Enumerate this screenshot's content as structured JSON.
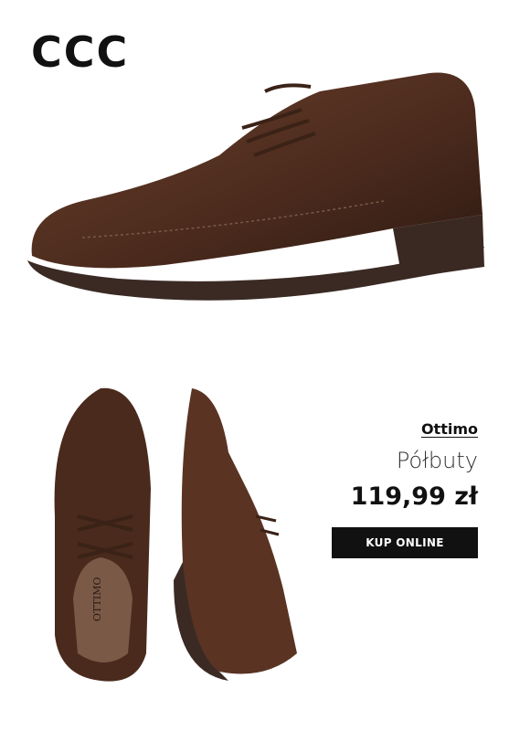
{
  "logo": "CCC",
  "product": {
    "brand": "Ottimo",
    "category": "Półbuty",
    "price": "119,99 zł",
    "cta": "KUP ONLINE",
    "insole_text": "OTTIMO"
  },
  "colors": {
    "leather": "#4a2a1d",
    "sole": "#3b2a24",
    "button_bg": "#111111"
  }
}
